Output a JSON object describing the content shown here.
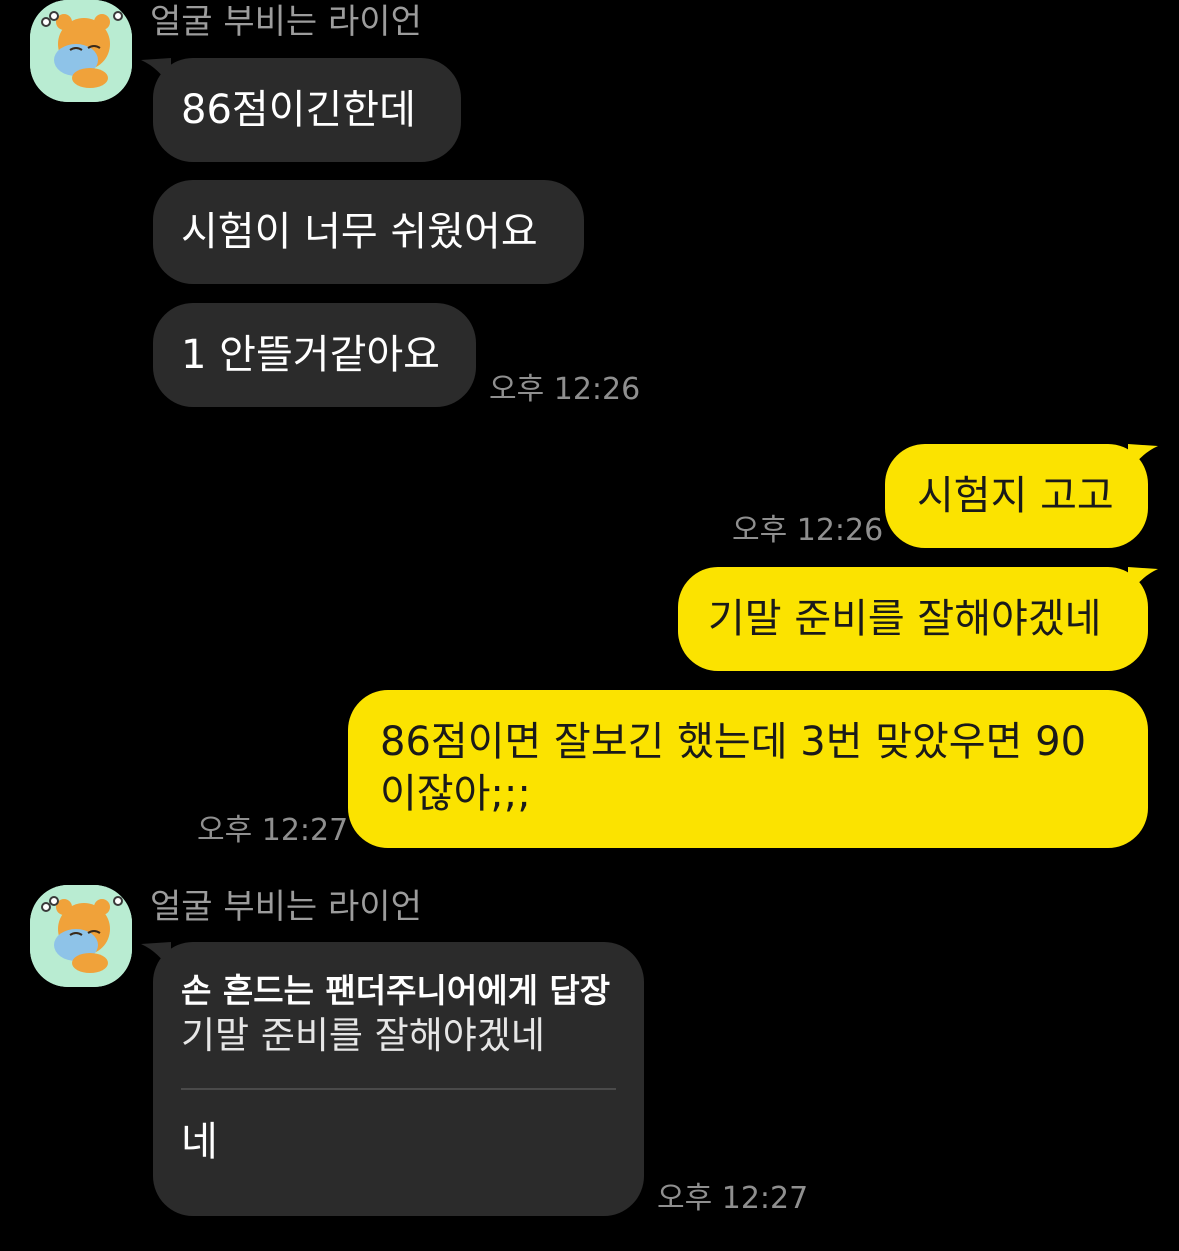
{
  "chat": {
    "sender_name": "얼굴 부비는 라이언",
    "avatar_icon": "ryan-character-hugging-pillow-icon",
    "colors": {
      "background": "#000000",
      "incoming_bubble": "#2b2b2b",
      "outgoing_bubble": "#fbe300",
      "avatar_bg": "#b9ecd2"
    },
    "group1": {
      "messages": [
        "86점이긴한데",
        "시험이 너무 쉬웠어요",
        "1 안뜰거같아요"
      ],
      "time": "오후 12:26"
    },
    "outgoing": [
      {
        "text": "시험지 고고",
        "time": "오후 12:26"
      },
      {
        "text": "기말 준비를 잘해야겠네"
      },
      {
        "line1": "86점이면 잘보긴 했는데 3번 맞았우면 90",
        "line2": "이잖아;;;",
        "time": "오후 12:27"
      }
    ],
    "group2": {
      "reply": {
        "header": "손 흔드는 팬더주니어에게 답장",
        "quoted": "기말 준비를 잘해야겠네",
        "body": "네"
      },
      "time": "오후 12:27"
    }
  }
}
